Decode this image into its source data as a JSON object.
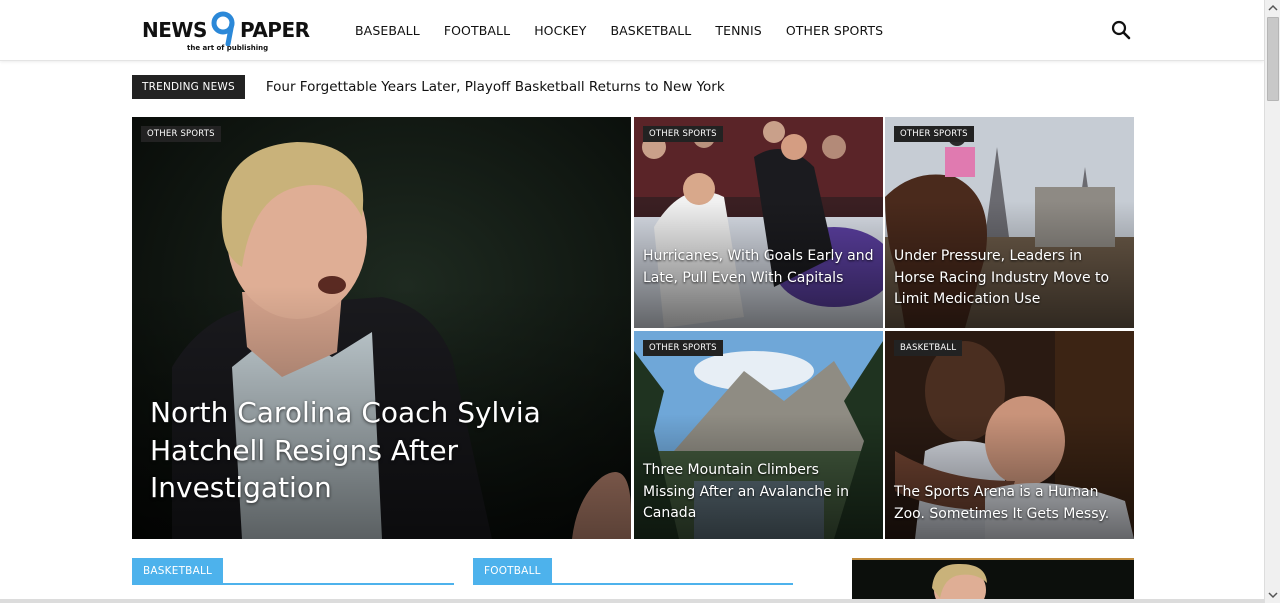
{
  "header": {
    "logo": {
      "left": "NEWS",
      "right": "PAPER",
      "tagline": "the art of publishing"
    },
    "nav": [
      "BASEBALL",
      "FOOTBALL",
      "HOCKEY",
      "BASKETBALL",
      "TENNIS",
      "OTHER SPORTS"
    ],
    "search_icon": "search-icon"
  },
  "trending": {
    "label": "TRENDING NEWS",
    "headline": "Four Forgettable Years Later, Playoff Basketball Returns to New York"
  },
  "featured": [
    {
      "category": "OTHER SPORTS",
      "title": "North Carolina Coach Sylvia Hatchell Resigns After Investigation"
    },
    {
      "category": "OTHER SPORTS",
      "title": "Hurricanes, With Goals Early and Late, Pull Even With Capitals"
    },
    {
      "category": "OTHER SPORTS",
      "title": "Under Pressure, Leaders in Horse Racing Industry Move to Limit Medication Use"
    },
    {
      "category": "OTHER SPORTS",
      "title": "Three Mountain Climbers Missing After an Avalanche in Canada"
    },
    {
      "category": "BASKETBALL",
      "title": "The Sports Arena is a Human Zoo. Sometimes It Gets Messy."
    }
  ],
  "sections": [
    "BASKETBALL",
    "FOOTBALL"
  ],
  "colors": {
    "accent": "#4db2ec",
    "logo_blue": "#2b88d8",
    "dark_label": "#222222"
  }
}
